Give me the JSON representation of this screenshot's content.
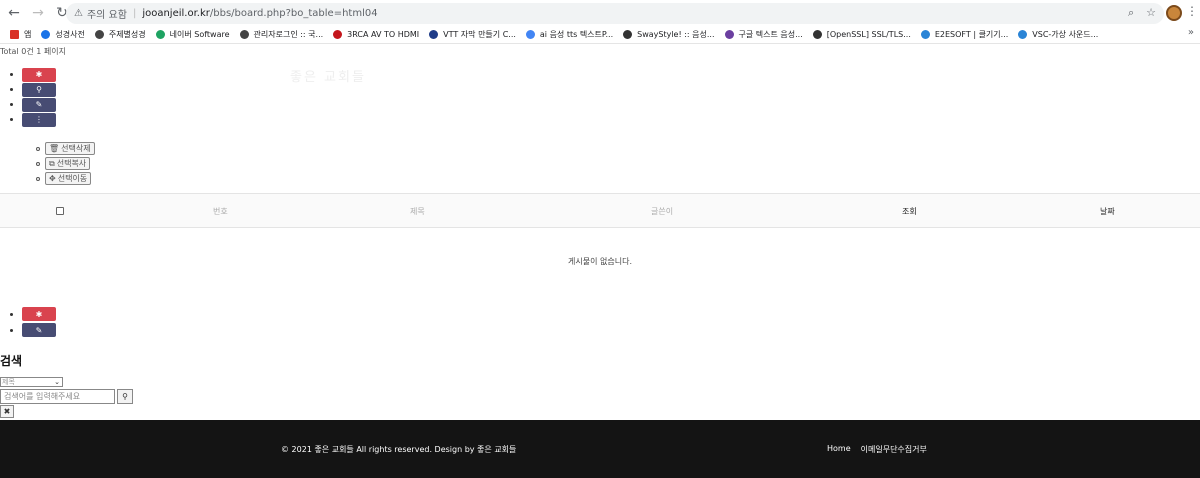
{
  "browser": {
    "back": "←",
    "forward": "→",
    "reload": "↻",
    "security": "주의 요함",
    "url_domain": "jooanjeil.or.kr",
    "url_path": "/bbs/board.php?bo_table=html04",
    "zoom_icon": "magnifier-icon",
    "more": "»"
  },
  "bookmarks": [
    {
      "label": "앱",
      "color": "#d93025"
    },
    {
      "label": "성경사전",
      "color": "#1a73e8"
    },
    {
      "label": "주제별성경",
      "color": "#444444"
    },
    {
      "label": "네이버 Software",
      "color": "#1ea362"
    },
    {
      "label": "관리자로그인 :: 국...",
      "color": "#444444"
    },
    {
      "label": "3RCA AV TO HDMI",
      "color": "#c4161c"
    },
    {
      "label": "VTT 자막 만들기 C...",
      "color": "#1f3c88"
    },
    {
      "label": "ai 음성 tts 텍스트P...",
      "color": "#4285f4"
    },
    {
      "label": "SwayStyle! :: 음성...",
      "color": "#333333"
    },
    {
      "label": "구글 텍스트 음성...",
      "color": "#6b3fa0"
    },
    {
      "label": "[OpenSSL] SSL/TLS...",
      "color": "#333333"
    },
    {
      "label": "E2ESOFT | 클기기...",
      "color": "#2a84d6"
    },
    {
      "label": "VSC-가상 사운드...",
      "color": "#2a84d6"
    }
  ],
  "board": {
    "total": "Total 0건 1 페이지",
    "title_faint": "좋은 교회들",
    "selection_buttons": [
      {
        "label": "선택삭제",
        "icon": "trash-icon"
      },
      {
        "label": "선택복사",
        "icon": "copy-icon"
      },
      {
        "label": "선택이동",
        "icon": "move-icon"
      }
    ],
    "columns": [
      "번호",
      "제목",
      "글쓴이",
      "조회",
      "날짜"
    ],
    "empty": "게시물이 없습니다."
  },
  "search": {
    "title": "검색",
    "select_value": "제목",
    "placeholder": "검색어를 입력해주세요"
  },
  "footer": {
    "copyright": "© 2021 좋은 교회들 All rights reserved. Design by 좋은 교회들",
    "links": [
      "Home",
      "이메일무단수집거부"
    ]
  },
  "colors": {
    "red": "#d9434e",
    "navy": "#474c73",
    "footer_bg": "#141414"
  }
}
